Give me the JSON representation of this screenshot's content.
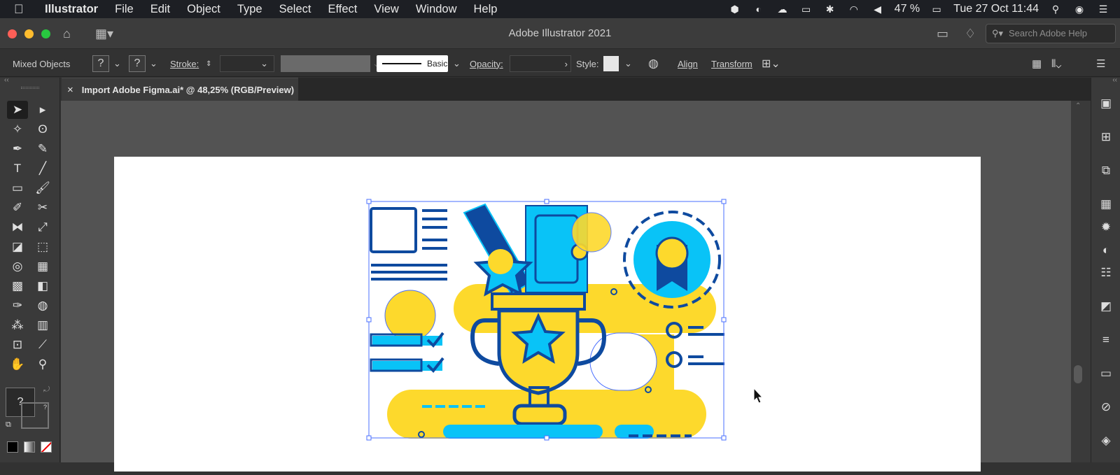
{
  "menubar": {
    "app": "Illustrator",
    "items": [
      "File",
      "Edit",
      "Object",
      "Type",
      "Select",
      "Effect",
      "View",
      "Window",
      "Help"
    ],
    "battery": "47 %",
    "clock": "Tue 27 Oct  11:44"
  },
  "window": {
    "title": "Adobe Illustrator 2021",
    "help_placeholder": "Search Adobe Help"
  },
  "control_bar": {
    "selection_label": "Mixed Objects",
    "fill_unknown": "?",
    "stroke_unknown": "?",
    "stroke_label": "Stroke:",
    "stroke_value": "",
    "profile_label": "Basic",
    "opacity_label": "Opacity:",
    "opacity_value": "",
    "style_label": "Style:",
    "align_label": "Align",
    "transform_label": "Transform"
  },
  "document_tab": {
    "close": "×",
    "title": "Import Adobe Figma.ai* @ 48,25% (RGB/Preview)"
  },
  "toolbox": {
    "color_unknown": "?",
    "swap_unknown": "?",
    "tools": [
      {
        "name": "selection-tool",
        "glyph": "➤"
      },
      {
        "name": "direct-selection-tool",
        "glyph": "▸"
      },
      {
        "name": "magic-wand-tool",
        "glyph": "✧"
      },
      {
        "name": "lasso-tool",
        "glyph": "ʘ"
      },
      {
        "name": "pen-tool",
        "glyph": "✒"
      },
      {
        "name": "curvature-tool",
        "glyph": "✎"
      },
      {
        "name": "type-tool",
        "glyph": "T"
      },
      {
        "name": "line-segment-tool",
        "glyph": "╱"
      },
      {
        "name": "rectangle-tool",
        "glyph": "▭"
      },
      {
        "name": "paintbrush-tool",
        "glyph": "🖌"
      },
      {
        "name": "shaper-tool",
        "glyph": "✐"
      },
      {
        "name": "scissors-tool",
        "glyph": "✂"
      },
      {
        "name": "reflect-tool",
        "glyph": "⧓"
      },
      {
        "name": "scale-tool",
        "glyph": "⤢"
      },
      {
        "name": "width-tool",
        "glyph": "◪"
      },
      {
        "name": "free-transform-tool",
        "glyph": "⬚"
      },
      {
        "name": "shape-builder-tool",
        "glyph": "◎"
      },
      {
        "name": "perspective-grid-tool",
        "glyph": "▦"
      },
      {
        "name": "mesh-tool",
        "glyph": "▩"
      },
      {
        "name": "gradient-tool",
        "glyph": "◧"
      },
      {
        "name": "eyedropper-tool",
        "glyph": "✑"
      },
      {
        "name": "blend-tool",
        "glyph": "◍"
      },
      {
        "name": "symbol-sprayer-tool",
        "glyph": "⁂"
      },
      {
        "name": "column-graph-tool",
        "glyph": "▥"
      },
      {
        "name": "artboard-tool",
        "glyph": "⊡"
      },
      {
        "name": "slice-tool",
        "glyph": "⟋"
      },
      {
        "name": "hand-tool",
        "glyph": "✋"
      },
      {
        "name": "zoom-tool",
        "glyph": "⚲"
      }
    ]
  },
  "right_dock": [
    "libraries-icon",
    "artboards-icon",
    "transform-panel-icon",
    "swatches-icon",
    "brushes-icon",
    "symbols-icon",
    "properties-icon",
    "color-guide-icon",
    "stroke-icon",
    "gradient-icon",
    "appearance-icon",
    "layers-icon"
  ],
  "colors": {
    "illustration_yellow": "#fdd92c",
    "illustration_cyan": "#09c3f7",
    "illustration_navy": "#0e4a9f",
    "selection_blue": "#4a6fff"
  }
}
